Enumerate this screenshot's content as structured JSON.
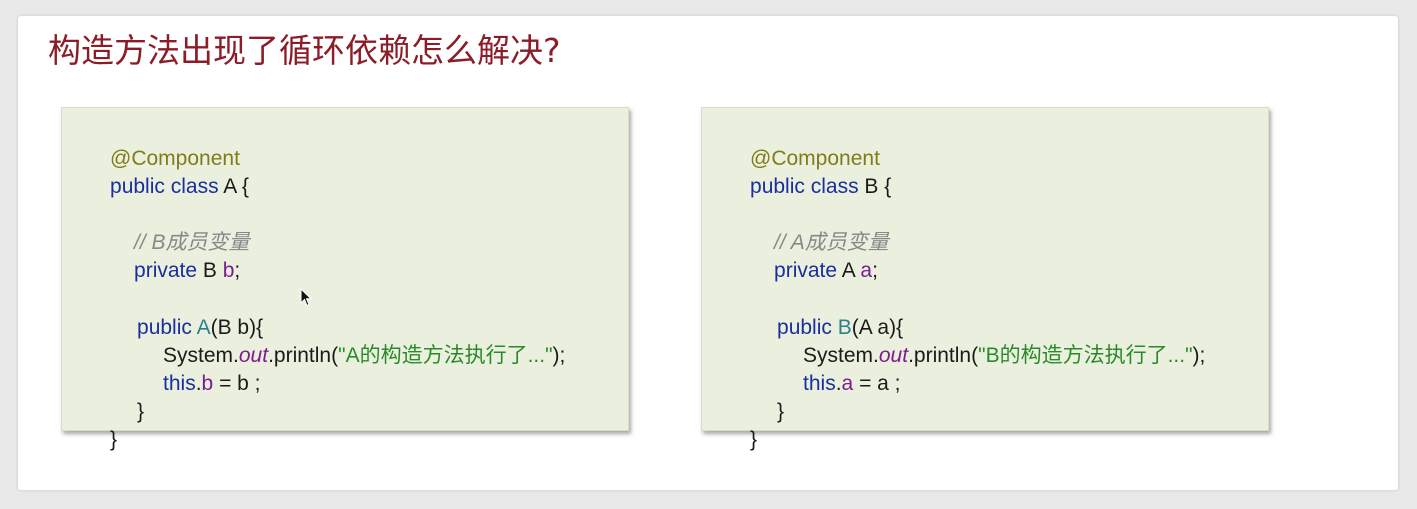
{
  "slide": {
    "title": "构造方法出现了循环依赖怎么解决?"
  },
  "code_a": {
    "annotation": "@Component",
    "class_kw": "public class",
    "class_name": " A {",
    "comment": "// B成员变量",
    "field_kw": "private",
    "field_type": " B ",
    "field_name": "b",
    "field_end": ";",
    "ctor_kw": "public",
    "ctor_name": " A",
    "ctor_params": "(B b){",
    "sys": "System.",
    "out": "out",
    "println": ".println(",
    "str": "\"A的构造方法执行了...\"",
    "println_end": ");",
    "this_kw": "this",
    "dot": ".",
    "assign_field": "b",
    "assign_rest": " = b ;",
    "close_inner": "}",
    "close_outer": "}"
  },
  "code_b": {
    "annotation": "@Component",
    "class_kw": "public class",
    "class_name": " B {",
    "comment": "// A成员变量",
    "field_kw": "private",
    "field_type": " A ",
    "field_name": "a",
    "field_end": ";",
    "ctor_kw": "public",
    "ctor_name": " B",
    "ctor_params": "(A a){",
    "sys": "System.",
    "out": "out",
    "println": ".println(",
    "str": "\"B的构造方法执行了...\"",
    "println_end": ");",
    "this_kw": "this",
    "dot": ".",
    "assign_field": "a",
    "assign_rest": " = a ;",
    "close_inner": "}",
    "close_outer": "}"
  },
  "colors": {
    "title": "#8b1d28",
    "annotation": "#807c1c",
    "keyword": "#1a2f9c",
    "comment": "#888888",
    "field": "#7b1d8e",
    "string": "#2a8a2a",
    "constructor": "#2b7f8f",
    "box_bg": "#ebf0de"
  }
}
